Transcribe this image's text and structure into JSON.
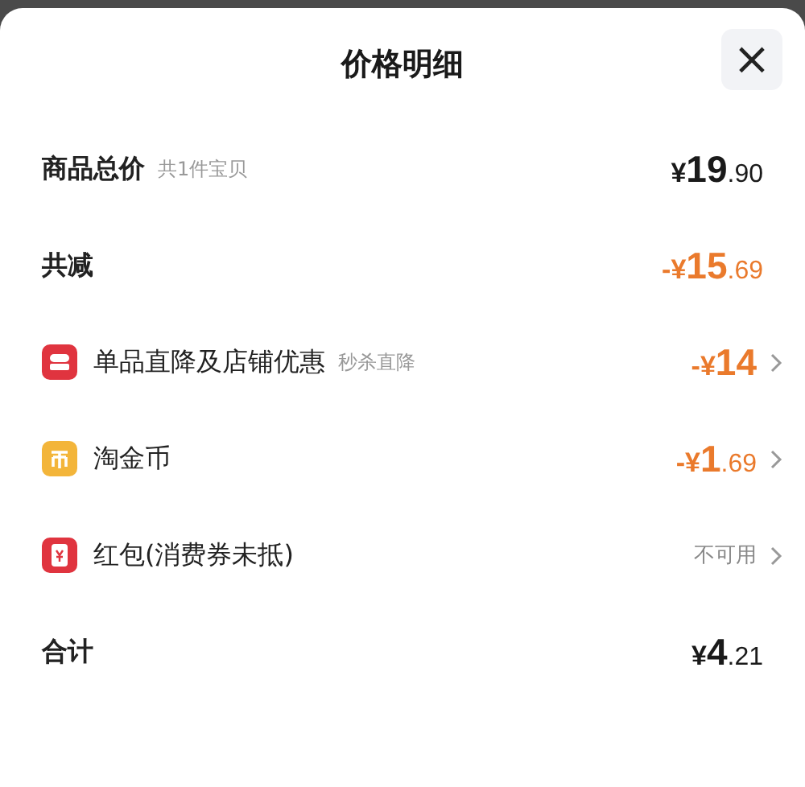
{
  "sheet": {
    "title": "价格明细",
    "close_label": "×"
  },
  "rows": [
    {
      "kind": "summary",
      "label": "商品总价",
      "hint": "共1件宝贝",
      "value": {
        "kind": "price",
        "prefix": "¥",
        "whole": "19",
        "fraction": ".90"
      }
    },
    {
      "kind": "summary",
      "label": "共减",
      "value": {
        "kind": "discount",
        "prefix": "-¥",
        "whole": "15",
        "fraction": ".69"
      }
    },
    {
      "kind": "shop",
      "label": "单品直降及店铺优惠",
      "hint": "秒杀直降",
      "value": {
        "kind": "discount",
        "prefix": "-¥",
        "whole": "14"
      }
    },
    {
      "kind": "coin",
      "label": "淘金币",
      "value": {
        "kind": "discount",
        "prefix": "-¥",
        "whole": "1",
        "fraction": ".69"
      }
    },
    {
      "kind": "envelope",
      "label": "红包(消费券未抵)",
      "value": {
        "kind": "note",
        "text": "不可用"
      }
    },
    {
      "kind": "summary",
      "label": "合计",
      "value": {
        "kind": "price",
        "prefix": "¥",
        "whole": "4",
        "fraction": ".21"
      }
    }
  ]
}
